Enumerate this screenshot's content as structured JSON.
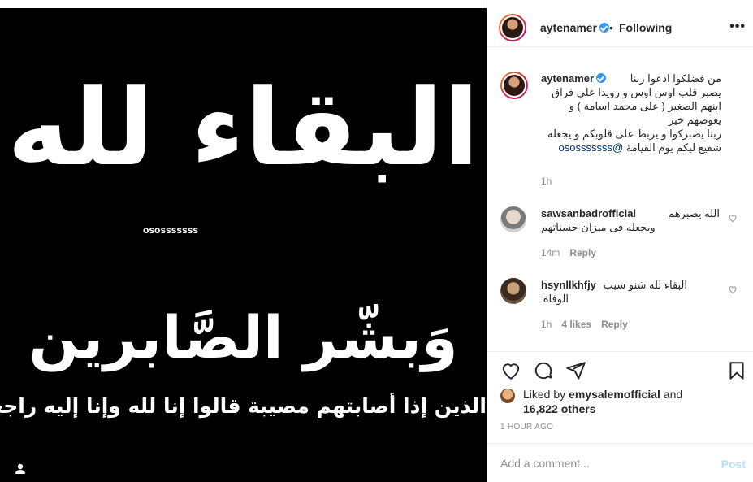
{
  "media": {
    "line1": "البقاء لله",
    "line2": "وَبشّر الصَّابرين",
    "line3": "الذين إذا أصابتهم مصيبة قالوا إنا لله وإنا إليه راجعون",
    "tagged_user": "ososssssss",
    "usertag_icon": "person-icon"
  },
  "header": {
    "username": "aytenamer",
    "separator": "•",
    "follow_status": "Following",
    "more_icon": "more-icon",
    "more_label": "•••"
  },
  "caption": {
    "username": "aytenamer",
    "lines": [
      "من فضلكوا ادعوا ربنا",
      "يصبر قلب اوس اوس و رويدا على فراق",
      "ابنهم الصغير ( على محمد اسامة ) و",
      "يعوضهم خير",
      "ربنا يصبركوا و يربط على قلوبكم و يجعله",
      "شفيع ليكم يوم القيامة"
    ],
    "mention": "@ososssssss",
    "time": "1h"
  },
  "comments": [
    {
      "username": "sawsanbadrofficial",
      "text_lines": [
        "الله يصبرهم",
        "ويجعله فى ميزان حسناتهم"
      ],
      "time": "14m",
      "likes": "",
      "reply": "Reply"
    },
    {
      "username": "hsynllkhfjy",
      "text_lines": [
        "البقاء لله شنو سبب",
        "الوفاة"
      ],
      "time": "1h",
      "likes": "4 likes",
      "reply": "Reply"
    }
  ],
  "actions": {
    "like_icon": "heart-icon",
    "comment_icon": "comment-icon",
    "share_icon": "share-icon",
    "save_icon": "bookmark-icon"
  },
  "likes": {
    "prefix": "Liked by",
    "user": "emysalemofficial",
    "and": "and",
    "others": "16,822 others"
  },
  "posted_ago": "1 HOUR AGO",
  "add_comment": {
    "placeholder": "Add a comment...",
    "post_label": "Post"
  }
}
